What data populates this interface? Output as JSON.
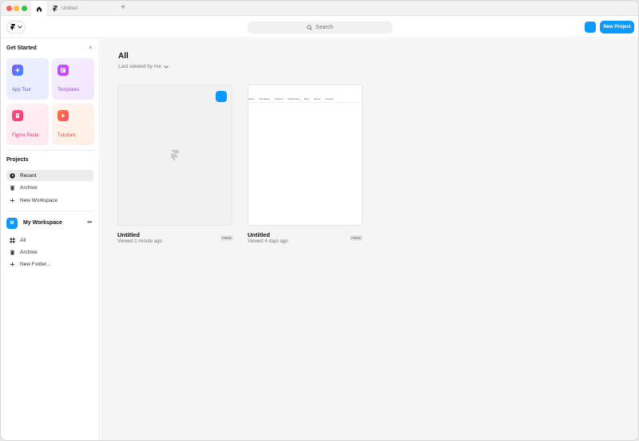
{
  "tabs": {
    "home_icon": "home-icon",
    "doc_tab_label": "Untitled",
    "add_tab_label": "+"
  },
  "topbar": {
    "search_label": "Search",
    "new_project_label": "New Project"
  },
  "get_started": {
    "title": "Get Started",
    "close_label": "×",
    "cards": [
      {
        "label": "App Tour",
        "icon": "sparkle-icon"
      },
      {
        "label": "Templates",
        "icon": "template-icon"
      },
      {
        "label": "Figma Paste",
        "icon": "figma-icon"
      },
      {
        "label": "Tutorials",
        "icon": "play-icon"
      }
    ]
  },
  "projects": {
    "title": "Projects",
    "items": [
      {
        "label": "Recent",
        "icon": "clock-icon",
        "active": true
      },
      {
        "label": "Archive",
        "icon": "trash-icon"
      },
      {
        "label": "New Workspace",
        "icon": "plus-icon"
      }
    ]
  },
  "workspace": {
    "avatar_letter": "M",
    "name": "My Workspace",
    "more_label": "•••",
    "items": [
      {
        "label": "All",
        "icon": "grid-icon"
      },
      {
        "label": "Archive",
        "icon": "trash-icon"
      },
      {
        "label": "New Folder...",
        "icon": "plus-icon"
      }
    ]
  },
  "main": {
    "heading": "All",
    "sort_label": "Last viewed by me",
    "projects": [
      {
        "name": "Untitled",
        "meta": "Viewed 1 minute ago",
        "badge": "FREE"
      },
      {
        "name": "Untitled",
        "meta": "Viewed 4 days ago",
        "badge": "FREE",
        "preview_nav": [
          "ellers",
          "Templates",
          "Jobsets",
          "Dashboard",
          "Blog",
          "About",
          "Careers"
        ]
      }
    ]
  },
  "colors": {
    "accent": "#0a99ff"
  }
}
